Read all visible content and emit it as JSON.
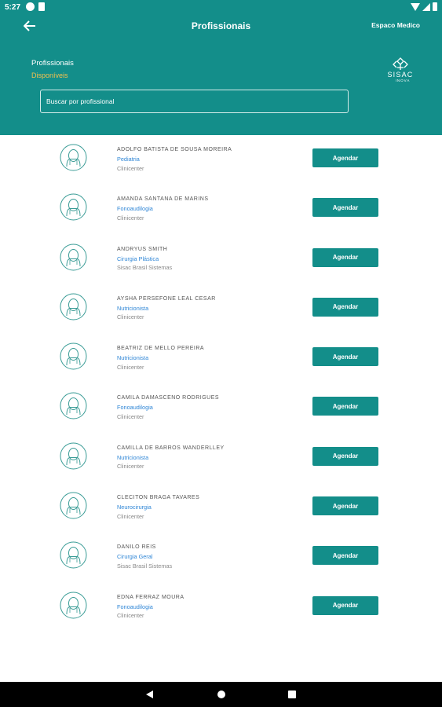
{
  "status_bar": {
    "time": "5:27"
  },
  "header": {
    "title": "Profissionais",
    "right_label": "Espaco Medico",
    "section_title": "Profissionais",
    "section_subtitle": "Disponíveis",
    "logo_text": "SISAC",
    "logo_sub": "INOVA",
    "search_placeholder": "Buscar por profissional",
    "accent_color": "#138e8a",
    "subtitle_color": "#f2c14e"
  },
  "professionals": [
    {
      "name": "ADOLFO BATISTA DE SOUSA MOREIRA",
      "specialty": "Pediatria",
      "clinic": "Clinicenter",
      "button": "Agendar"
    },
    {
      "name": "AMANDA SANTANA DE MARINS",
      "specialty": "Fonoaudilogia",
      "clinic": "Clinicenter",
      "button": "Agendar"
    },
    {
      "name": "ANDRYUS SMITH",
      "specialty": "Cirurgia Plástica",
      "clinic": "Sisac Brasil Sistemas",
      "button": "Agendar"
    },
    {
      "name": "AYSHA PERSEFONE LEAL CESAR",
      "specialty": "Nutricionista",
      "clinic": "Clinicenter",
      "button": "Agendar"
    },
    {
      "name": "BEATRIZ DE MELLO PEREIRA",
      "specialty": "Nutricionista",
      "clinic": "Clinicenter",
      "button": "Agendar"
    },
    {
      "name": "CAMILA DAMASCENO RODRIGUES",
      "specialty": "Fonoaudilogia",
      "clinic": "Clinicenter",
      "button": "Agendar"
    },
    {
      "name": "CAMILLA DE BARROS WANDERLLEY",
      "specialty": "Nutricionista",
      "clinic": "Clinicenter",
      "button": "Agendar"
    },
    {
      "name": "CLECITON BRAGA TAVARES",
      "specialty": "Neurocirurgia",
      "clinic": "Clinicenter",
      "button": "Agendar"
    },
    {
      "name": "DANILO REIS",
      "specialty": "Cirurgia Geral",
      "clinic": "Sisac Brasil Sistemas",
      "button": "Agendar"
    },
    {
      "name": "EDNA FERRAZ MOURA",
      "specialty": "Fonoaudilogia",
      "clinic": "Clinicenter",
      "button": "Agendar"
    }
  ],
  "icons": {
    "back": "arrow-left-icon",
    "avatar": "doctor-avatar-icon",
    "logo": "sisac-logo"
  }
}
